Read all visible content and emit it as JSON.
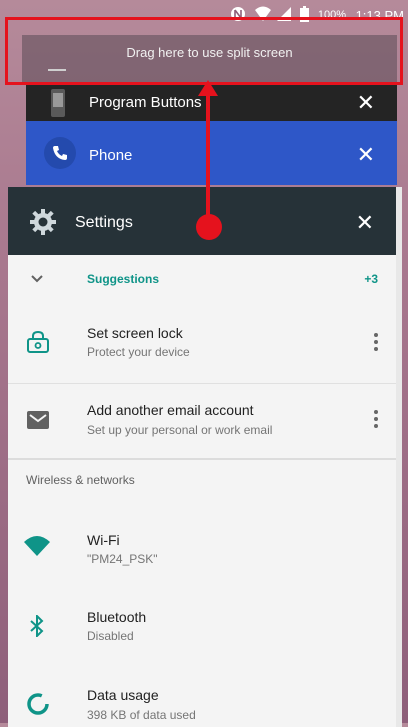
{
  "status_bar": {
    "battery": "100%",
    "time": "1:13 PM"
  },
  "split_screen": {
    "hint": "Drag here to use split screen"
  },
  "cards": {
    "program_buttons": {
      "title": "Program Buttons",
      "close": "✕"
    },
    "phone": {
      "title": "Phone",
      "close": "✕"
    },
    "settings": {
      "title": "Settings",
      "close": "✕"
    }
  },
  "settings": {
    "suggestions": {
      "label": "Suggestions",
      "count": "+3"
    },
    "items": [
      {
        "title": "Set screen lock",
        "subtitle": "Protect your device"
      },
      {
        "title": "Add another email account",
        "subtitle": "Set up your personal or work email"
      }
    ],
    "section": "Wireless & networks",
    "network_items": [
      {
        "title": "Wi-Fi",
        "subtitle": "\"PM24_PSK\""
      },
      {
        "title": "Bluetooth",
        "subtitle": "Disabled"
      },
      {
        "title": "Data usage",
        "subtitle": "398 KB of data used"
      }
    ]
  },
  "colors": {
    "accent_teal": "#0f9488",
    "annotation_red": "#e5121d",
    "phone_blue": "#2e57c8",
    "settings_header": "#263238"
  }
}
